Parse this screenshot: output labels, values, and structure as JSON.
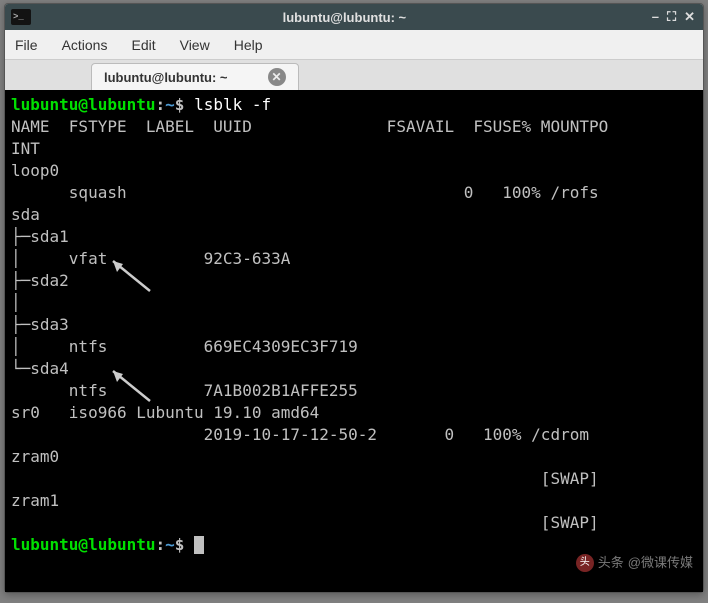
{
  "window": {
    "title": "lubuntu@lubuntu: ~"
  },
  "menu": {
    "file": "File",
    "actions": "Actions",
    "edit": "Edit",
    "view": "View",
    "help": "Help"
  },
  "tab": {
    "label": "lubuntu@lubuntu: ~"
  },
  "prompt": {
    "userhost": "lubuntu@lubuntu",
    "colon": ":",
    "path": "~",
    "sign": "$"
  },
  "command": "lsblk -f",
  "header": "NAME  FSTYPE  LABEL  UUID              FSAVAIL  FSUSE% MOUNTPO\nINT",
  "rows": {
    "loop0": "loop0",
    "loop0_line": "      squash                                   0   100% /rofs",
    "sda": "sda",
    "sda1": "├─sda1",
    "sda1_line": "│     vfat          92C3-633A",
    "sda2": "├─sda2",
    "sda2_blank": "│",
    "sda3": "├─sda3",
    "sda3_line": "│     ntfs          669EC4309EC3F719",
    "sda4": "└─sda4",
    "sda4_line": "      ntfs          7A1B002B1AFFE255",
    "sr0": "sr0   iso966 Lubuntu 19.10 amd64",
    "sr0_line": "                    2019-10-17-12-50-2       0   100% /cdrom",
    "zram0": "zram0",
    "zram0_line": "                                                       [SWAP]",
    "zram1": "zram1",
    "zram1_line": "                                                       [SWAP]"
  },
  "watermark": "@微课传媒",
  "watermark_prefix": "头条"
}
